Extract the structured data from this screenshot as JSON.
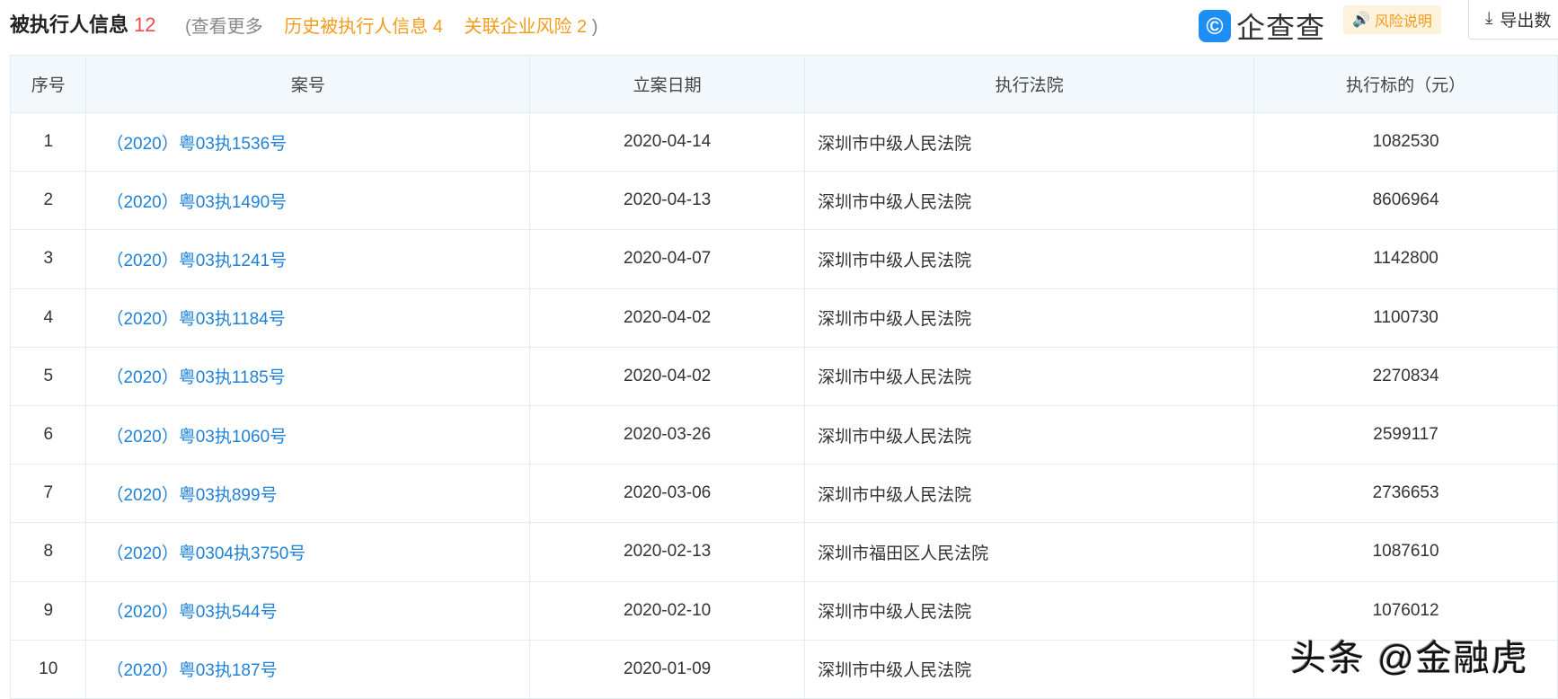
{
  "header": {
    "title": "被执行人信息",
    "count": "12",
    "more_prefix": "(查看更多",
    "history": "历史被执行人信息 4",
    "related": "关联企业风险 2",
    "more_suffix": ")"
  },
  "brand": {
    "logo_text": "企查查",
    "risk_label": "风险说明",
    "export_label": "导出数"
  },
  "table": {
    "columns": [
      "序号",
      "案号",
      "立案日期",
      "执行法院",
      "执行标的（元）"
    ],
    "rows": [
      [
        "1",
        "（2020）粤03执1536号",
        "2020-04-14",
        "深圳市中级人民法院",
        "1082530"
      ],
      [
        "2",
        "（2020）粤03执1490号",
        "2020-04-13",
        "深圳市中级人民法院",
        "8606964"
      ],
      [
        "3",
        "（2020）粤03执1241号",
        "2020-04-07",
        "深圳市中级人民法院",
        "1142800"
      ],
      [
        "4",
        "（2020）粤03执1184号",
        "2020-04-02",
        "深圳市中级人民法院",
        "1100730"
      ],
      [
        "5",
        "（2020）粤03执1185号",
        "2020-04-02",
        "深圳市中级人民法院",
        "2270834"
      ],
      [
        "6",
        "（2020）粤03执1060号",
        "2020-03-26",
        "深圳市中级人民法院",
        "2599117"
      ],
      [
        "7",
        "（2020）粤03执899号",
        "2020-03-06",
        "深圳市中级人民法院",
        "2736653"
      ],
      [
        "8",
        "（2020）粤0304执3750号",
        "2020-02-13",
        "深圳市福田区人民法院",
        "1087610"
      ],
      [
        "9",
        "（2020）粤03执544号",
        "2020-02-10",
        "深圳市中级人民法院",
        "1076012"
      ],
      [
        "10",
        "（2020）粤03执187号",
        "2020-01-09",
        "深圳市中级人民法院",
        ""
      ]
    ]
  },
  "watermark": "头条 @金融虎"
}
